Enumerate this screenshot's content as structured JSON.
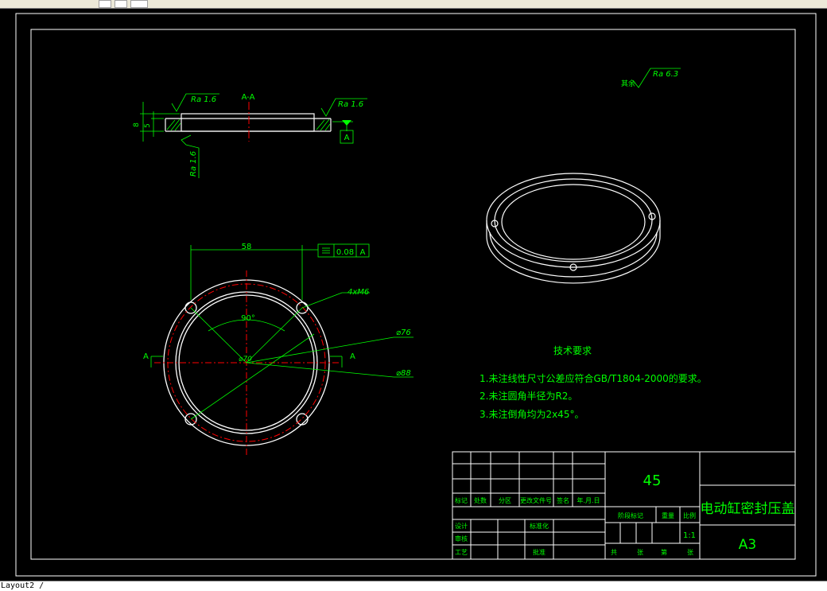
{
  "tabs": {
    "layout_tab": "Layout2 /"
  },
  "colors": {
    "background": "#000000",
    "geometry": "#ffffff",
    "dimension": "#00ff00",
    "centerline": "#ff0000",
    "frame": "#ffffff"
  },
  "section_view": {
    "label": "A-A",
    "roughness_left": "Ra 1.6",
    "roughness_right": "Ra 1.6",
    "roughness_bottom": "Ra 1.6",
    "dim_8": "8",
    "dim_5": "5",
    "datum": "A"
  },
  "roughness_rest": {
    "prefix": "其余",
    "value": "Ra 6.3"
  },
  "plan_view": {
    "dim_58": "58",
    "flatness_value": "0.08",
    "flatness_datum": "A",
    "holes": "4xM6",
    "angle": "90°",
    "dia_76": "⌀76",
    "dia_88": "⌀88",
    "dia_70": "⌀70",
    "section_mark_left": "A",
    "section_mark_right": "A"
  },
  "tech_requirements": {
    "title": "技术要求",
    "items": [
      "1.未注线性尺寸公差应符合GB/T1804-2000的要求。",
      "2.未注圆角半径为R2。",
      "3.未注倒角均为2x45°。"
    ]
  },
  "title_block": {
    "material": "45",
    "part_name": "电动缸密封压盖",
    "sheet_size": "A3",
    "scale": "1:1",
    "row_header": [
      "标记",
      "处数",
      "分区",
      "更改文件号",
      "签名",
      "年.月.日"
    ],
    "designer": "设计",
    "standardization": "标准化",
    "checker": "审核",
    "process": "工艺",
    "approve": "批准",
    "stage_mark": "阶段标记",
    "weight": "重量",
    "scale_label": "比例",
    "total": "共",
    "sheet": "张",
    "page": "第",
    "page_end": "张"
  }
}
